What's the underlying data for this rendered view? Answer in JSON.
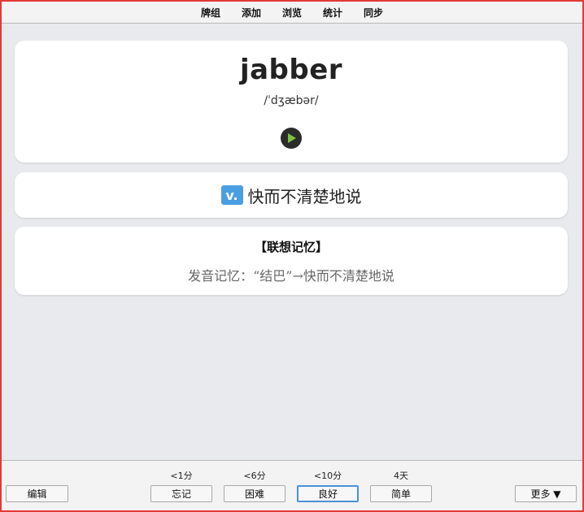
{
  "topbar": {
    "items": [
      "牌组",
      "添加",
      "浏览",
      "统计",
      "同步"
    ]
  },
  "card": {
    "word": "jabber",
    "phonetic": "/ˈdʒæbər/",
    "play_icon": "play-icon",
    "pos": "v.",
    "definition": "快而不清楚地说",
    "memo_title": "【联想记忆】",
    "memo_text": "发音记忆：“结巴”→快而不清楚地说"
  },
  "bottombar": {
    "edit_label": "编辑",
    "more_label": "更多 ▼",
    "answers": [
      {
        "label": "忘记",
        "interval": "<1分"
      },
      {
        "label": "困难",
        "interval": "<6分"
      },
      {
        "label": "良好",
        "interval": "<10分"
      },
      {
        "label": "简单",
        "interval": "4天"
      }
    ]
  },
  "colors": {
    "frame_border": "#e53935",
    "pos_badge": "#4a9fe3",
    "play_triangle": "#7cc242"
  }
}
